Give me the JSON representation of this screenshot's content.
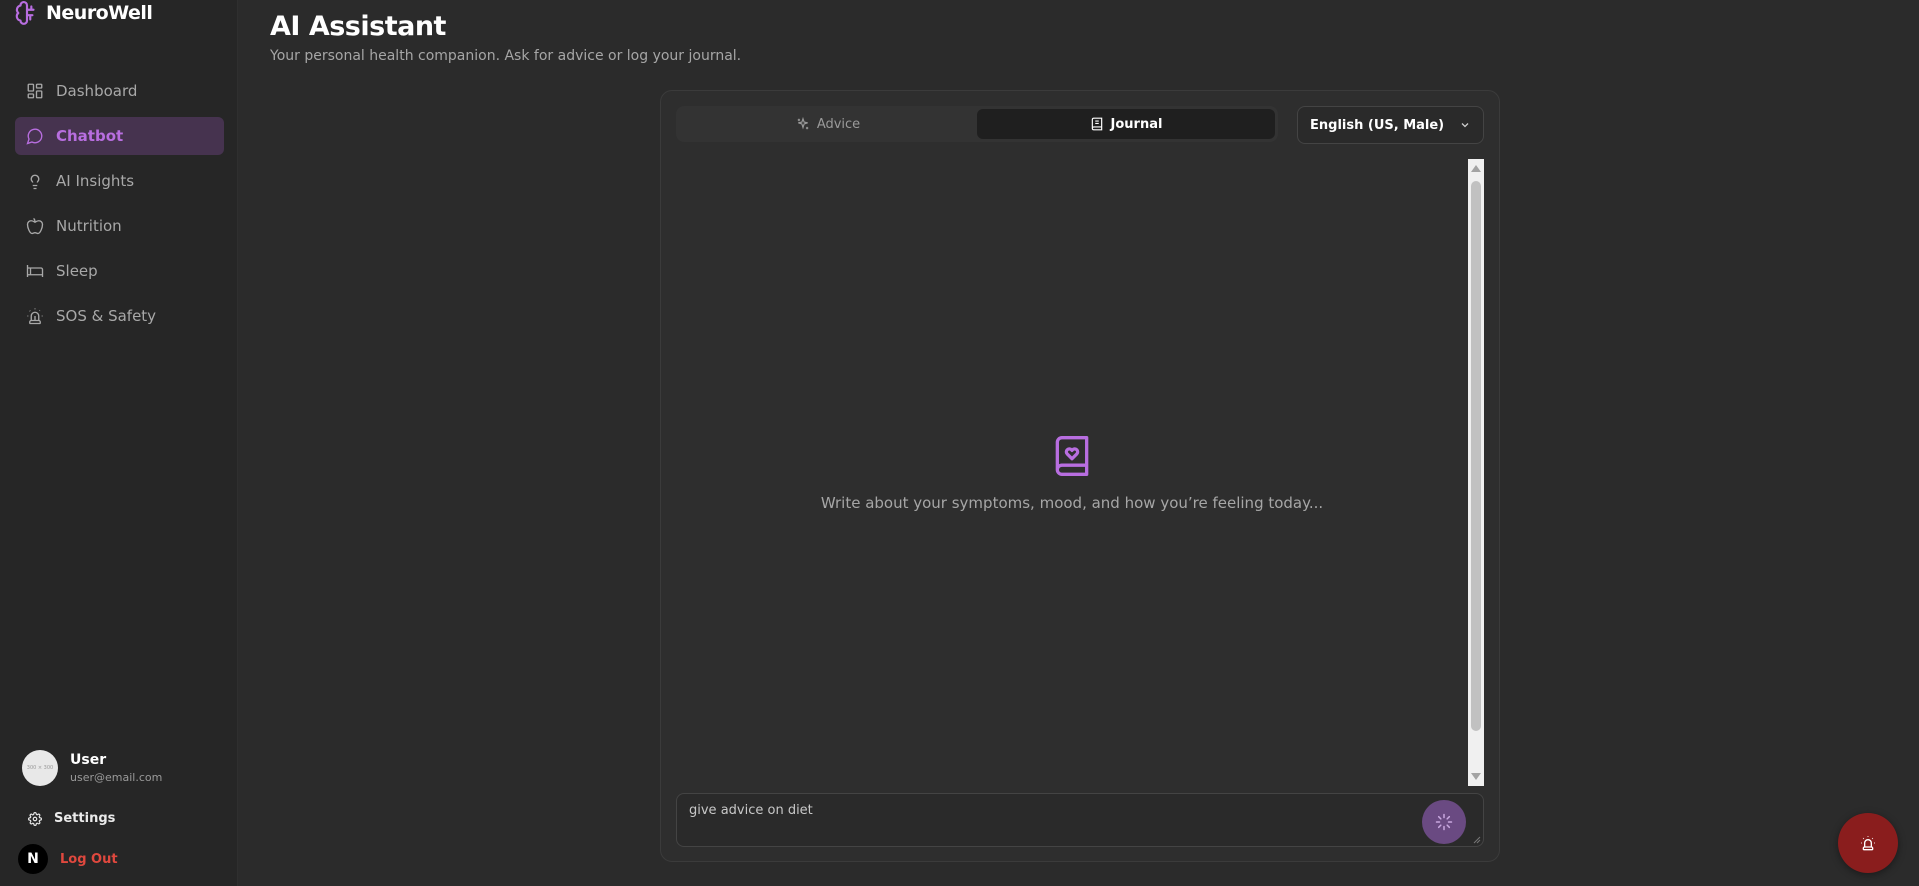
{
  "brand": {
    "name": "NeuroWell",
    "icon": "brain-icon"
  },
  "sidebar": {
    "items": [
      {
        "label": "Dashboard",
        "icon": "layout-grid-icon"
      },
      {
        "label": "Chatbot",
        "icon": "message-circle-icon",
        "active": true
      },
      {
        "label": "AI Insights",
        "icon": "lightbulb-icon"
      },
      {
        "label": "Nutrition",
        "icon": "apple-icon"
      },
      {
        "label": "Sleep",
        "icon": "bed-icon"
      },
      {
        "label": "SOS & Safety",
        "icon": "siren-icon"
      }
    ],
    "user": {
      "name": "User",
      "email": "user@email.com",
      "avatar_text": "300 × 300"
    },
    "settings_label": "Settings",
    "logout_label": "Log Out",
    "logout_badge": "N"
  },
  "header": {
    "title": "AI Assistant",
    "subtitle": "Your personal health companion. Ask for advice or log your journal."
  },
  "chat": {
    "tabs": [
      {
        "label": "Advice",
        "icon": "sparkles-icon",
        "active": false
      },
      {
        "label": "Journal",
        "icon": "book-icon",
        "active": true
      }
    ],
    "language": {
      "selected": "English (US, Male)"
    },
    "empty_state": {
      "icon": "book-heart-icon",
      "text": "Write about your symptoms, mood, and how you’re feeling today..."
    },
    "input": {
      "value": "give advice on diet"
    }
  },
  "colors": {
    "accent": "#b86ee0",
    "danger": "#e0483e",
    "sos": "#8a1d1d"
  }
}
